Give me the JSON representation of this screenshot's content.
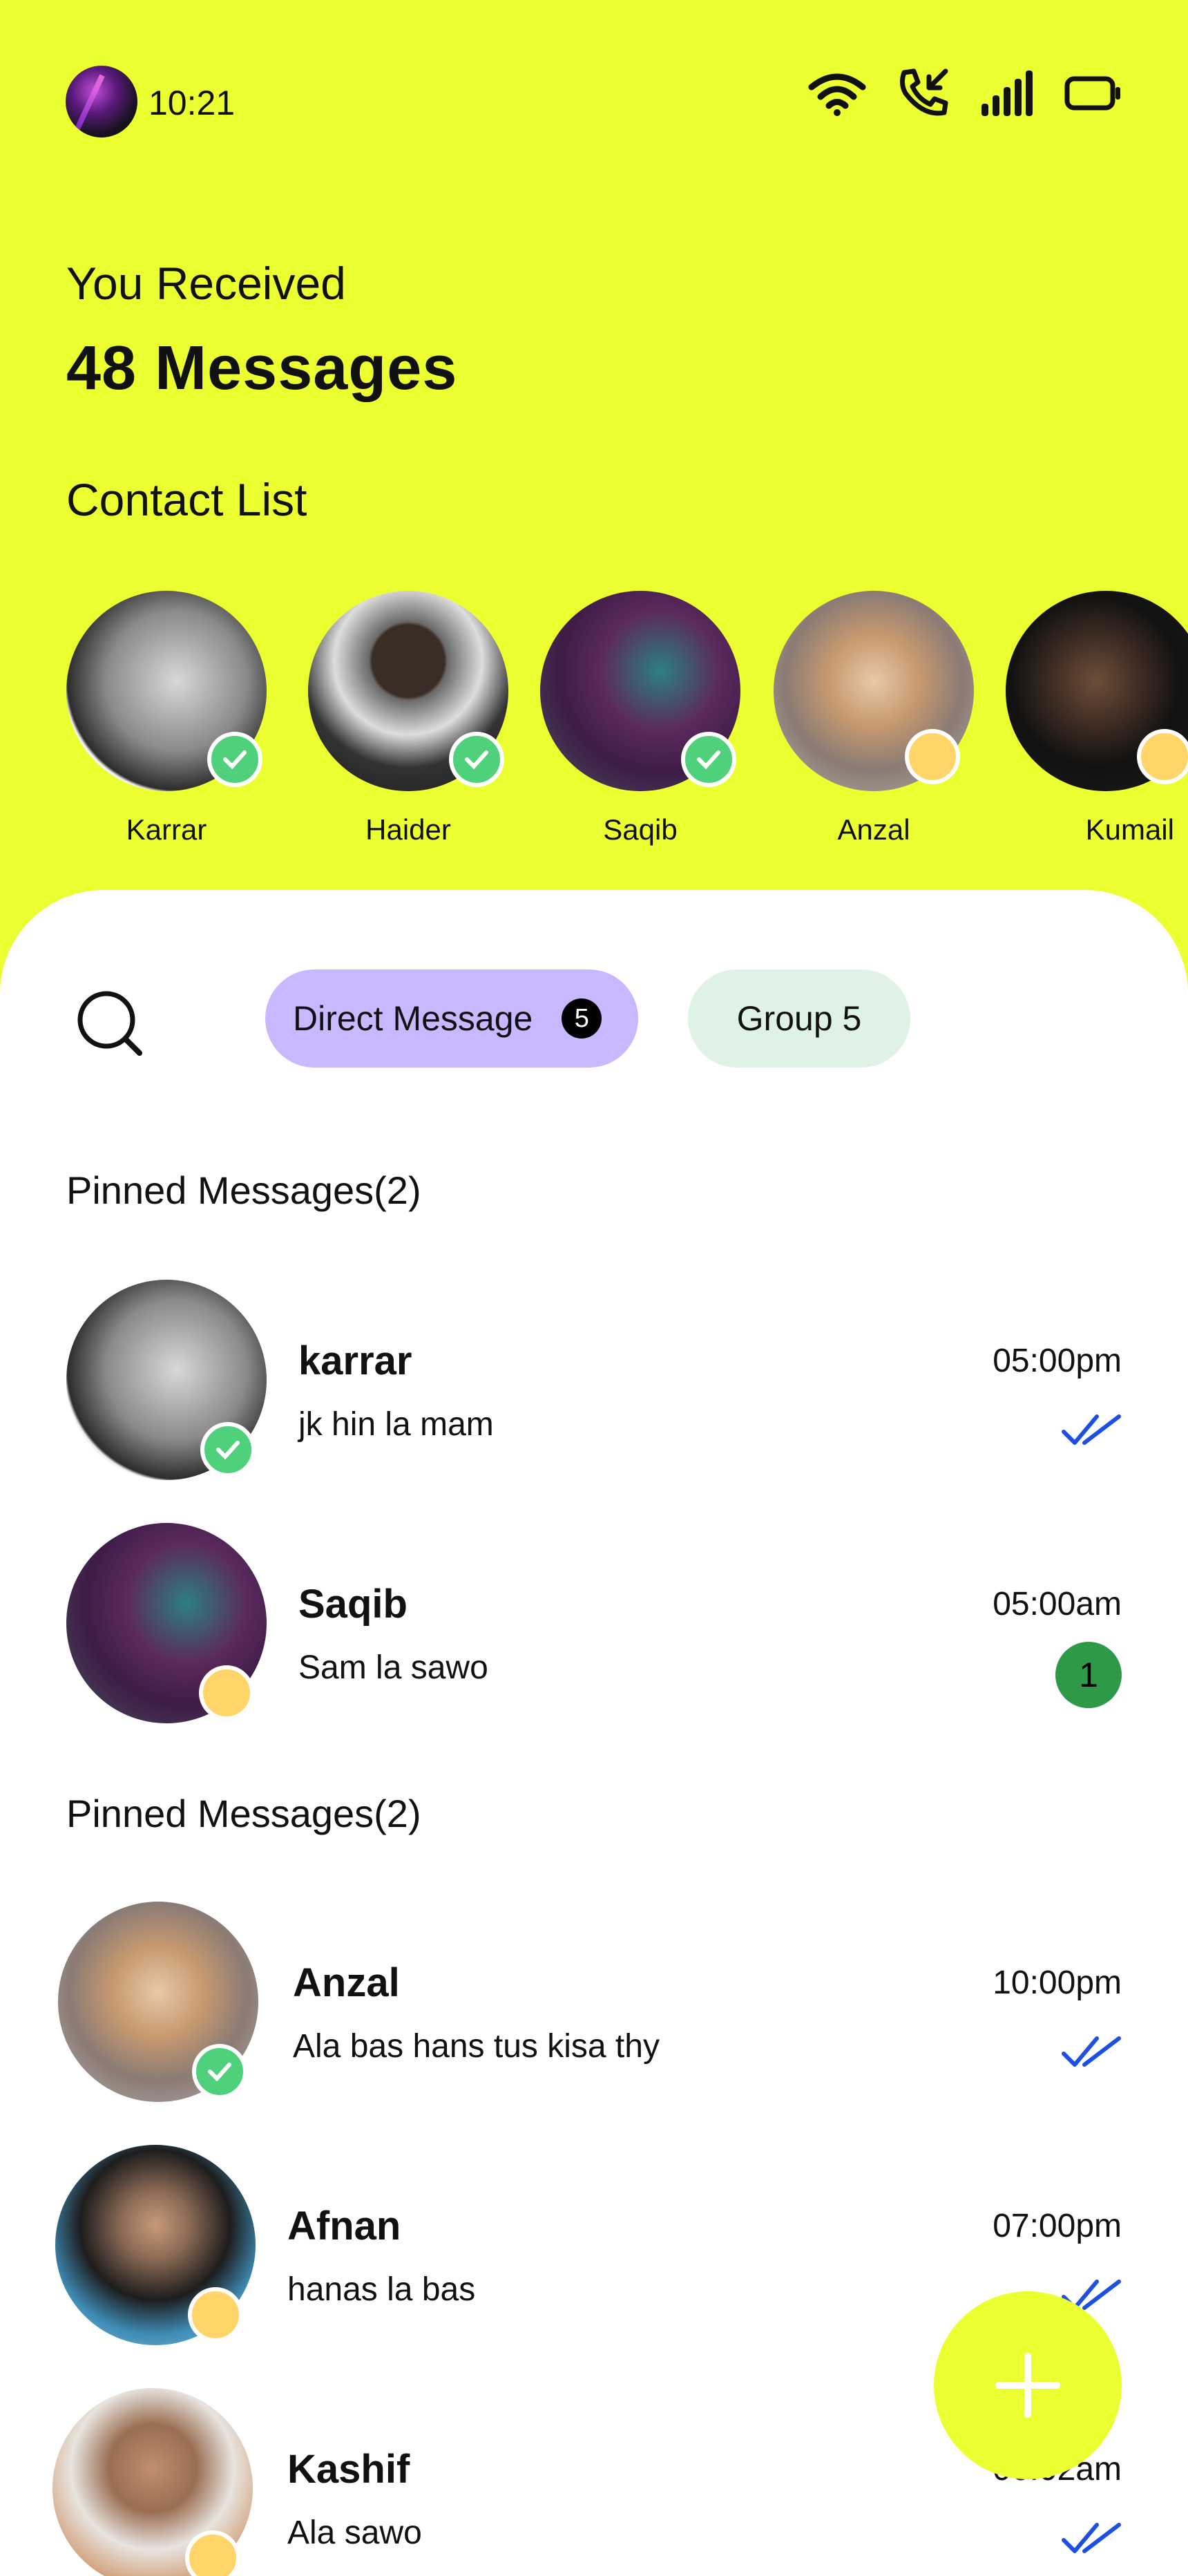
{
  "status": {
    "time": "10:21"
  },
  "header": {
    "received": "You Received",
    "messages_count": "48 Messages",
    "contact_list_title": "Contact List"
  },
  "contacts": [
    {
      "name": "Karrar",
      "status": "online"
    },
    {
      "name": "Haider",
      "status": "online"
    },
    {
      "name": "Saqib",
      "status": "online"
    },
    {
      "name": "Anzal",
      "status": "away"
    },
    {
      "name": "Kumail",
      "status": "away"
    }
  ],
  "tabs": {
    "direct_label": "Direct Message",
    "direct_count": "5",
    "group_label": "Group 5"
  },
  "sections": [
    {
      "title": "Pinned Messages(2)"
    },
    {
      "title": "Pinned Messages(2)"
    }
  ],
  "messages": [
    {
      "name": "karrar",
      "text": "jk hin la mam",
      "time": "05:00pm",
      "state": "read",
      "status": "online"
    },
    {
      "name": "Saqib",
      "text": "Sam la sawo",
      "time": "05:00am",
      "unread": "1",
      "status": "away"
    },
    {
      "name": "Anzal",
      "text": "Ala bas hans tus kisa thy",
      "time": "10:00pm",
      "state": "read",
      "status": "online"
    },
    {
      "name": "Afnan",
      "text": "hanas la bas",
      "time": "07:00pm",
      "state": "read",
      "status": "away"
    },
    {
      "name": "Kashif",
      "text": "Ala sawo",
      "time": "06:02am",
      "state": "read",
      "status": "away"
    }
  ],
  "colors": {
    "background": "#ebff31",
    "chip_direct": "#c8b8ff",
    "chip_group": "#dff2e6",
    "online": "#4fd17b",
    "away": "#ffd56a",
    "tick": "#1f4fe0",
    "unread_badge": "#2e9a47"
  },
  "icons": [
    "wifi-icon",
    "missed-call-icon",
    "signal-icon",
    "battery-icon",
    "search-icon",
    "double-check-icon",
    "plus-icon"
  ]
}
